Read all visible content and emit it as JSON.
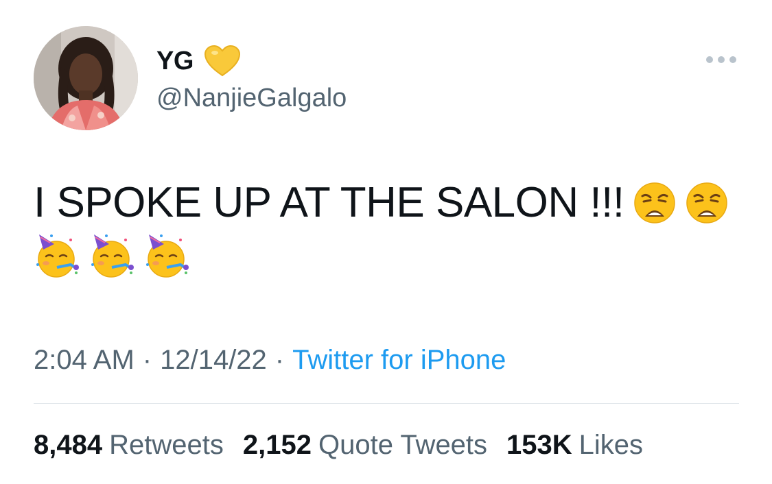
{
  "author": {
    "display_name": "YG",
    "handle": "@NanjieGalgalo",
    "badge_icon": "yellow-heart-icon"
  },
  "tweet": {
    "text": "I SPOKE UP AT THE SALON !!!",
    "emojis_line1": [
      "weary-face-icon",
      "weary-face-icon"
    ],
    "emojis_line2": [
      "partying-face-icon",
      "partying-face-icon",
      "partying-face-icon"
    ]
  },
  "meta": {
    "time": "2:04 AM",
    "separator": "·",
    "date": "12/14/22",
    "source": "Twitter for iPhone"
  },
  "stats": {
    "retweets_count": "8,484",
    "retweets_label": "Retweets",
    "quotes_count": "2,152",
    "quotes_label": "Quote Tweets",
    "likes_count": "153K",
    "likes_label": "Likes"
  },
  "colors": {
    "text_primary": "#0f1419",
    "text_secondary": "#536471",
    "link": "#1d9bf0",
    "divider": "#e1e6ea"
  }
}
